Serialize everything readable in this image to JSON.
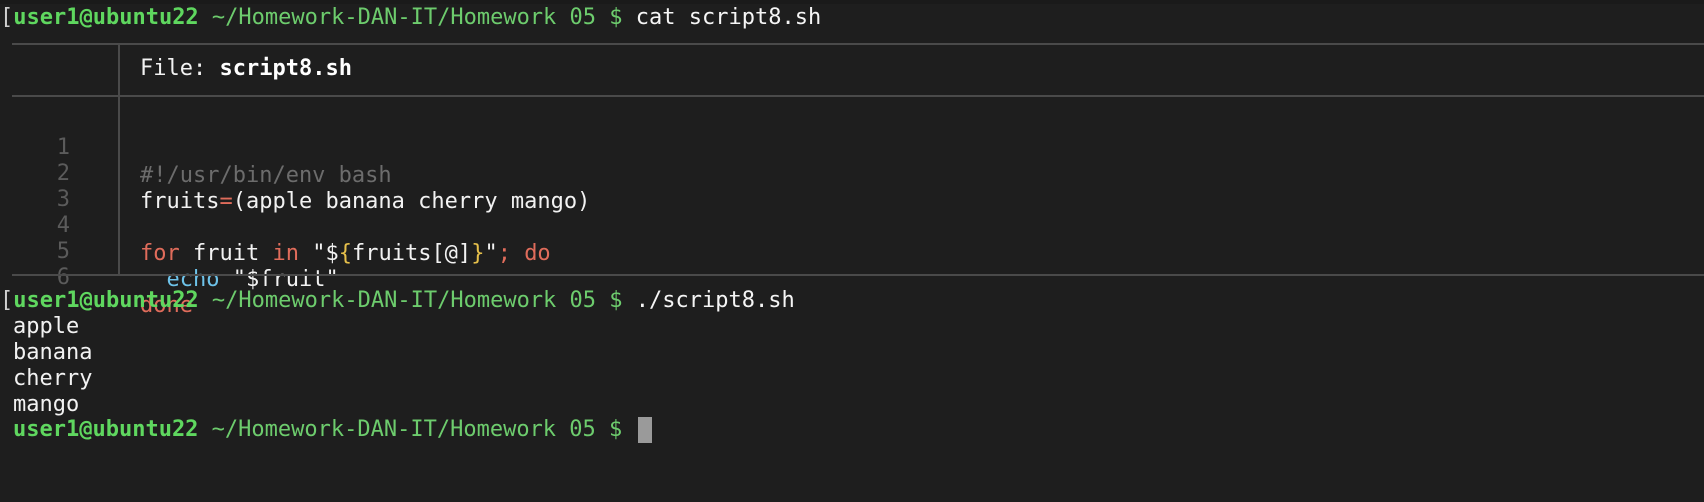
{
  "prompt": {
    "bracket": "[",
    "user_host": "user1@ubuntu22",
    "path": " ~/Homework-DAN-IT/Homework 05 $ "
  },
  "commands": {
    "first": "cat script8.sh",
    "second": "./script8.sh"
  },
  "file_header": {
    "label": "File: ",
    "name": "script8.sh"
  },
  "code_lines": {
    "numbers": [
      "1",
      "2",
      "3",
      "4",
      "5",
      "6"
    ],
    "l1": "#!/usr/bin/env bash",
    "l2_var": "fruits",
    "l2_op": "=",
    "l2_rest": "(apple banana cherry mango)",
    "l4_for": "for",
    "l4_var": " fruit ",
    "l4_in": "in",
    "l4_q1": " \"$",
    "l4_brace_open": "{",
    "l4_mid": "fruits[@]",
    "l4_brace_close": "}",
    "l4_q2": "\"",
    "l4_semi": ";",
    "l4_sp": " ",
    "l4_do": "do",
    "l5_indent": "  ",
    "l5_echo": "echo",
    "l5_rest": " \"$fruit\"",
    "l6_done": "done"
  },
  "output_lines": [
    "apple",
    "banana",
    "cherry",
    "mango"
  ]
}
